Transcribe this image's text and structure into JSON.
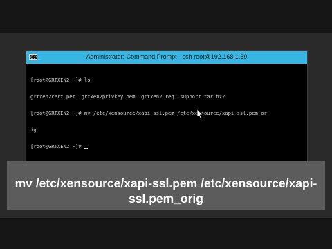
{
  "window": {
    "title": "Administrator: Command Prompt - ssh  root@192.168.1.39",
    "icon": "C:\\_"
  },
  "terminal": {
    "lines": [
      "[root@GRTXEN2 ~]# ls",
      "grtxen2cert.pem  grtxen2privkey.pem  grtxen2.req  support.tar.bz2",
      "[root@GRTXEN2 ~]# mv /etc/xensource/xapi-ssl.pem /etc/xensource/xapi-ssl.pem_or",
      "ig",
      "[root@GRTXEN2 ~]# "
    ]
  },
  "caption": {
    "line1": "mv /etc/xensource/xapi-ssl.pem /etc/xensource/xapi-",
    "line2": "ssl.pem_orig"
  },
  "colors": {
    "titlebar": "#37b6e4",
    "terminal_bg": "#000000",
    "terminal_text": "#d0d0d0",
    "caption_band": "#5c5c5c"
  }
}
